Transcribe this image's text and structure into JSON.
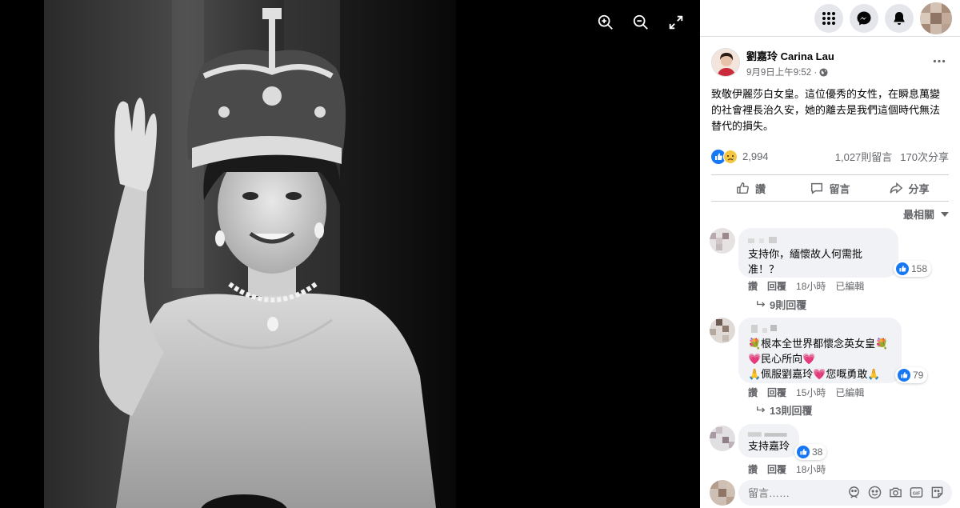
{
  "viewer": {
    "tools": [
      {
        "name": "zoom-in-icon"
      },
      {
        "name": "zoom-out-icon"
      },
      {
        "name": "fullscreen-icon"
      }
    ]
  },
  "topbar": {
    "icons": [
      "menu-grid-icon",
      "messenger-icon",
      "notifications-bell-icon"
    ]
  },
  "post": {
    "author": "劉嘉玲 Carina Lau",
    "timestamp": "9月9日上午9:52 ·",
    "text": "致敬伊麗莎白女皇。這位優秀的女性，在瞬息萬變的社會裡長治久安，她的離去是我們這個時代無法替代的損失。",
    "reactions_count": "2,994",
    "comments_count": "1,027則留言",
    "shares_count": "170次分享"
  },
  "actions": {
    "like": "讚",
    "comment": "留言",
    "share": "分享"
  },
  "sort_label": "最相關",
  "comments": [
    {
      "text_lines": [
        "支持你，緬懷故人何需批",
        "准！？"
      ],
      "likes": "158",
      "reply": "讚",
      "reply2": "回覆",
      "time": "18小時",
      "edited": "已編輯",
      "replies": "9則回覆"
    },
    {
      "text_lines": [
        "💐根本全世界都懷念英女皇💐",
        "💗民心所向💗",
        "🙏佩服劉嘉玲💗您嘅勇敢🙏"
      ],
      "likes": "79",
      "reply": "讚",
      "reply2": "回覆",
      "time": "15小時",
      "edited": "已編輯",
      "replies": "13則回覆"
    },
    {
      "text_lines": [
        "支持嘉玲"
      ],
      "likes": "38",
      "reply": "讚",
      "reply2": "回覆",
      "time": "18小時"
    }
  ],
  "composer": {
    "placeholder": "留言……"
  },
  "colors": {
    "like_blue": "#1877f2",
    "panel_bg": "#ffffff",
    "bubble_bg": "#f0f2f5",
    "secondary_text": "#65676b"
  }
}
